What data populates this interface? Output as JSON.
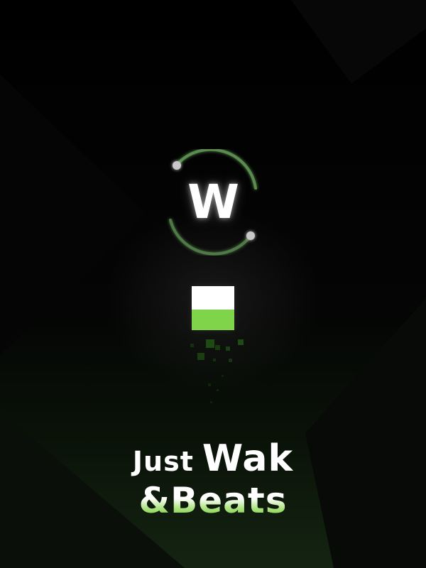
{
  "app": {
    "logo_letter": "W",
    "title_line_1": {
      "word_1": "Just",
      "word_2": "Wak"
    },
    "title_line_2": "&Beats"
  },
  "loader": {
    "progress": 0.47,
    "colors": {
      "filled": "#ffffff",
      "empty": "#7fd44a"
    }
  },
  "theme": {
    "background": "#000000",
    "accent_green": "#7fd44a",
    "ring_green": "#5a8c50",
    "ring_dot": "#c8c8c8",
    "footer_glow": "#142412"
  }
}
